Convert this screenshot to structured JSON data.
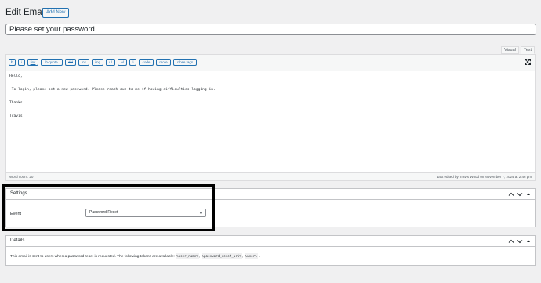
{
  "header": {
    "title": "Edit Email",
    "add_new_label": "Add New"
  },
  "title_field": {
    "value": "Please set your password"
  },
  "editor": {
    "tabs": [
      "Visual",
      "Text"
    ],
    "active_tab": "Text",
    "quicktags": [
      "b",
      "i",
      "link",
      "b-quote",
      "del",
      "ins",
      "img",
      "ul",
      "ol",
      "li",
      "code",
      "more",
      "close tags"
    ],
    "content_lines": [
      "Hello,",
      " To login, please set a new password. Please reach out to me if having difficulties logging in.",
      "Thanks",
      "Travis"
    ],
    "word_count": "Word count: 20",
    "last_edited": "Last edited by Travis Wood on November 7, 2024 at 2:46 pm"
  },
  "settings": {
    "title": "Settings",
    "event_label": "Event",
    "event_value": "Password Reset"
  },
  "details": {
    "title": "Details",
    "text_before": "This email is sent to users when a password reset is requested. The following tokens are available:",
    "tokens": [
      "%user_name%",
      "%password_reset_url%",
      "%user%"
    ],
    "text_after": "."
  },
  "colors": {
    "accent": "#2271b1",
    "background": "#f0f0f1",
    "highlight_border": "#000000"
  }
}
